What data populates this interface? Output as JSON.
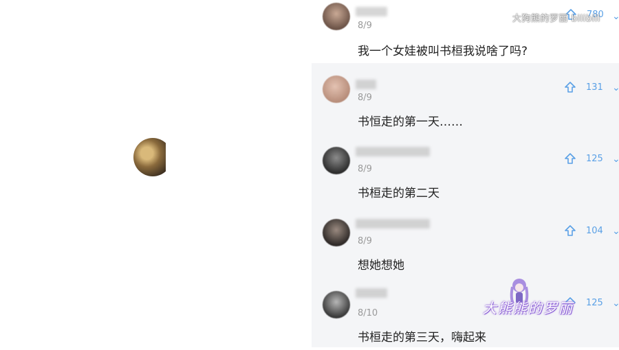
{
  "watermark": {
    "top": "大狗熊的罗丽 bilibili",
    "bottom": "大熊熊的罗丽"
  },
  "main_comment": {
    "date": "8/9",
    "text": "我一个女娃被叫书桓我说啥了吗?",
    "votes": "780"
  },
  "replies": [
    {
      "date": "8/9",
      "text": "书恒走的第一天……",
      "votes": "131"
    },
    {
      "date": "8/9",
      "text": "书桓走的第二天",
      "votes": "125"
    },
    {
      "date": "8/9",
      "text": "想她想她",
      "votes": "104"
    },
    {
      "date": "8/10",
      "text": "书桓走的第三天，嗨起来",
      "votes": "125"
    }
  ],
  "colors": {
    "accent": "#5aa0e6",
    "reply_bg": "#f4f5f7",
    "date": "#999999",
    "text": "#222222"
  }
}
